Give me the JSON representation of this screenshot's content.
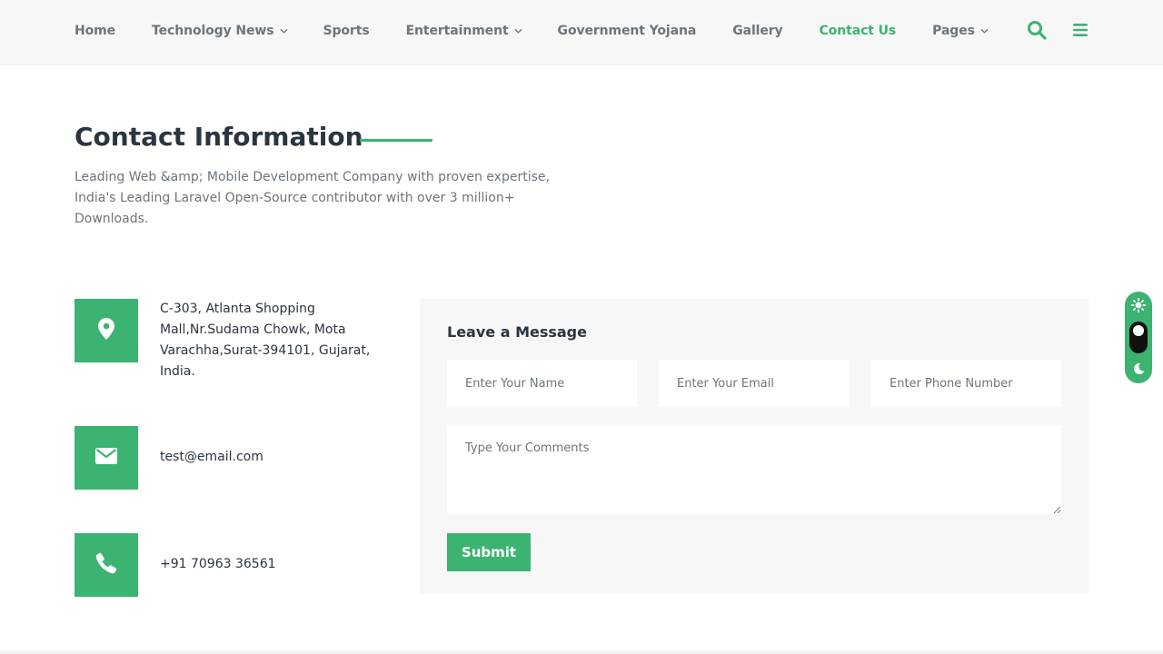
{
  "colors": {
    "accent": "#3cb371",
    "heading": "#2b3541",
    "muted": "#6c757d",
    "panel": "#f7f7f7"
  },
  "nav": {
    "items": [
      {
        "label": "Home",
        "dropdown": false,
        "active": false
      },
      {
        "label": "Technology News",
        "dropdown": true,
        "active": false
      },
      {
        "label": "Sports",
        "dropdown": false,
        "active": false
      },
      {
        "label": "Entertainment",
        "dropdown": true,
        "active": false
      },
      {
        "label": "Government Yojana",
        "dropdown": false,
        "active": false
      },
      {
        "label": "Gallery",
        "dropdown": false,
        "active": false
      },
      {
        "label": "Contact Us",
        "dropdown": false,
        "active": true
      },
      {
        "label": "Pages",
        "dropdown": true,
        "active": false
      }
    ],
    "icons": [
      "search-icon",
      "menu-icon"
    ]
  },
  "contact": {
    "title": "Contact Information",
    "intro": "Leading Web &amp; Mobile Development Company with proven expertise, India's Leading Laravel Open-Source contributor with over 3 million+ Downloads.",
    "address": {
      "icon": "map-marker-icon",
      "text": "C-303, Atlanta Shopping Mall,Nr.Sudama Chowk, Mota Varachha,Surat-394101, Gujarat, India."
    },
    "email": {
      "icon": "envelope-icon",
      "text": "test@email.com"
    },
    "phone": {
      "icon": "phone-icon",
      "text": "+91 70963 36561"
    }
  },
  "form": {
    "title": "Leave a Message",
    "name_placeholder": "Enter Your Name",
    "email_placeholder": "Enter Your Email",
    "phone_placeholder": "Enter Phone Number",
    "comments_placeholder": "Type Your Comments",
    "submit_label": "Submit"
  },
  "theme_toggle": {
    "icons": [
      "sun-icon",
      "moon-icon"
    ],
    "mode": "light"
  }
}
